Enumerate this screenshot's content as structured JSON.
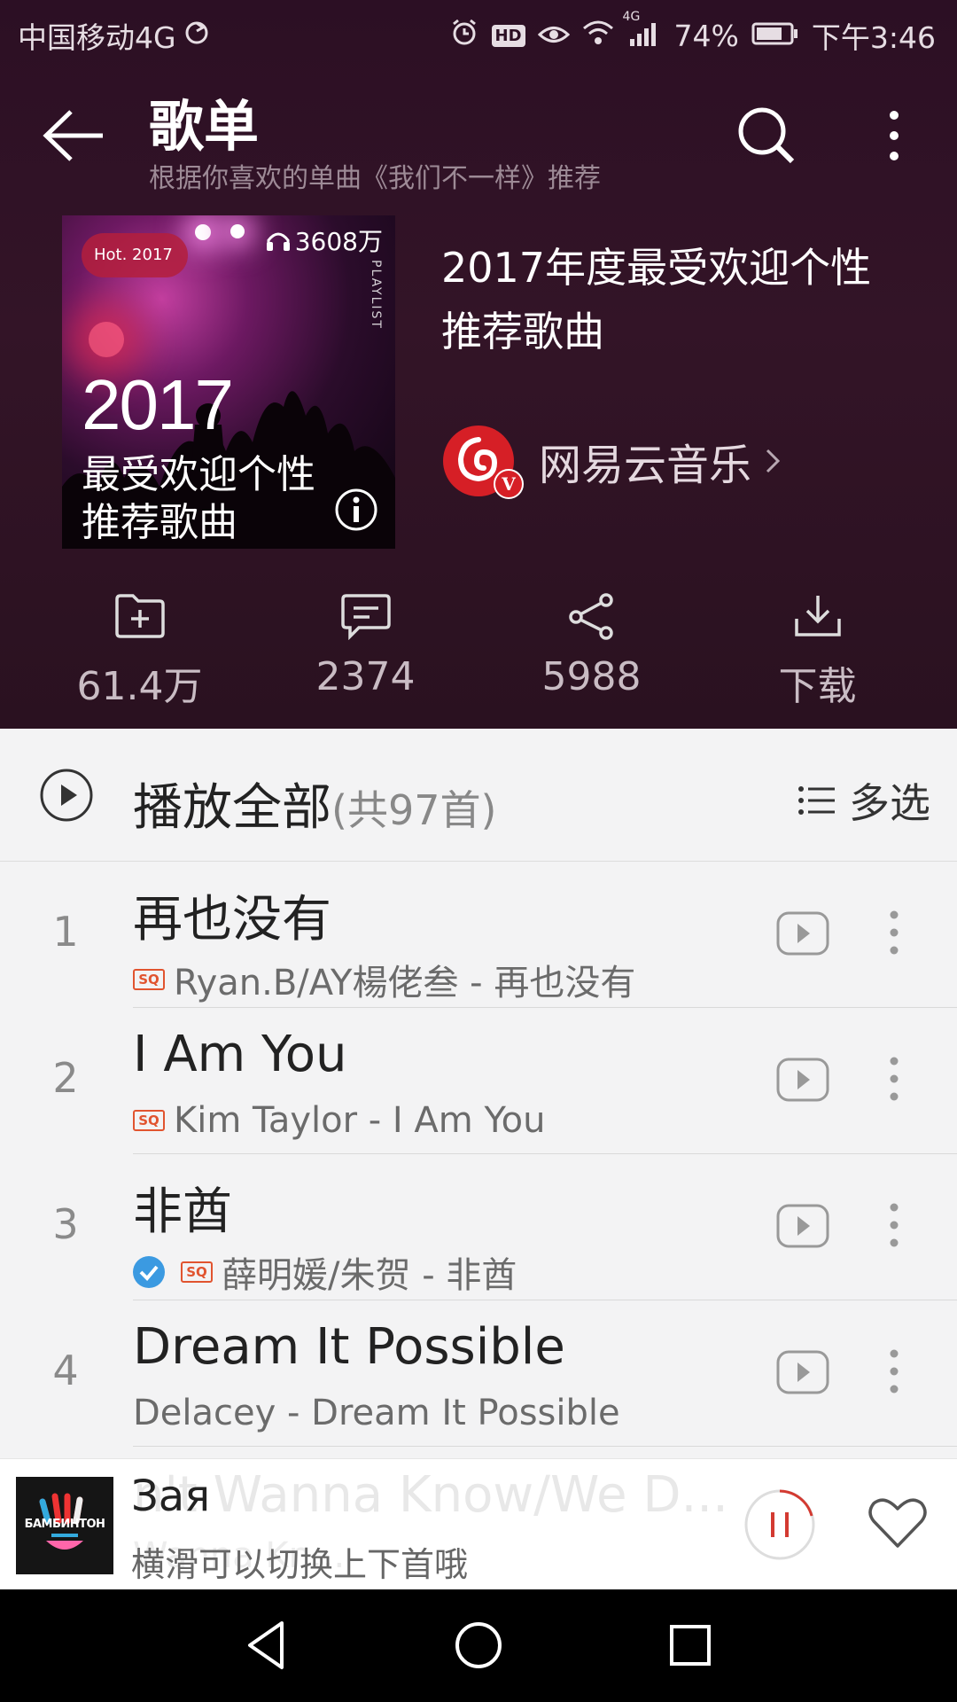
{
  "status_bar": {
    "carrier": "中国移动4G",
    "network": "4G",
    "battery": "74%",
    "time": "下午3:46",
    "hd": "HD"
  },
  "header": {
    "title": "歌单",
    "subtitle": "根据你喜欢的单曲《我们不一样》推荐"
  },
  "playlist": {
    "cover": {
      "hot_tag": "Hot. 2017",
      "play_count": "3608万",
      "vertical_text": "PLAYLIST",
      "year": "2017",
      "line1": "最受欢迎个性",
      "line2": "推荐歌曲"
    },
    "name": "2017年度最受欢迎个性推荐歌曲",
    "creator": "网易云音乐",
    "creator_badge": "V"
  },
  "actions": [
    {
      "label": "61.4万",
      "icon": "add-folder-icon"
    },
    {
      "label": "2374",
      "icon": "comment-icon"
    },
    {
      "label": "5988",
      "icon": "share-icon"
    },
    {
      "label": "下载",
      "icon": "download-icon"
    }
  ],
  "play_all": {
    "label": "播放全部",
    "count": "(共97首)",
    "multi_select": "多选"
  },
  "songs": [
    {
      "index": "1",
      "title": "再也没有",
      "subtitle": "Ryan.B/AY楊佬叁 - 再也没有",
      "sq": true,
      "downloaded": false
    },
    {
      "index": "2",
      "title": "I Am You",
      "subtitle": "Kim Taylor - I Am You",
      "sq": true,
      "downloaded": false
    },
    {
      "index": "3",
      "title": "非酋",
      "subtitle": "薛明媛/朱贺 - 非酋",
      "sq": true,
      "downloaded": true
    },
    {
      "index": "4",
      "title": "Dream It Possible",
      "subtitle": "Delacey - Dream It Possible",
      "sq": false,
      "downloaded": false
    }
  ],
  "sq_label": "SQ",
  "mini_player": {
    "title": "Зая",
    "subtitle": "横滑可以切换上下首哦",
    "cover_text": "БАМБИНТОН",
    "ghost_title": "n't Wanna Know/We D...",
    "ghost_sub": "Wanna Kn..."
  },
  "colors": {
    "header_bg": "#2c0f24",
    "accent_red": "#e1542f",
    "netease_red": "#d61f26",
    "verified_blue": "#3b9ae1"
  }
}
